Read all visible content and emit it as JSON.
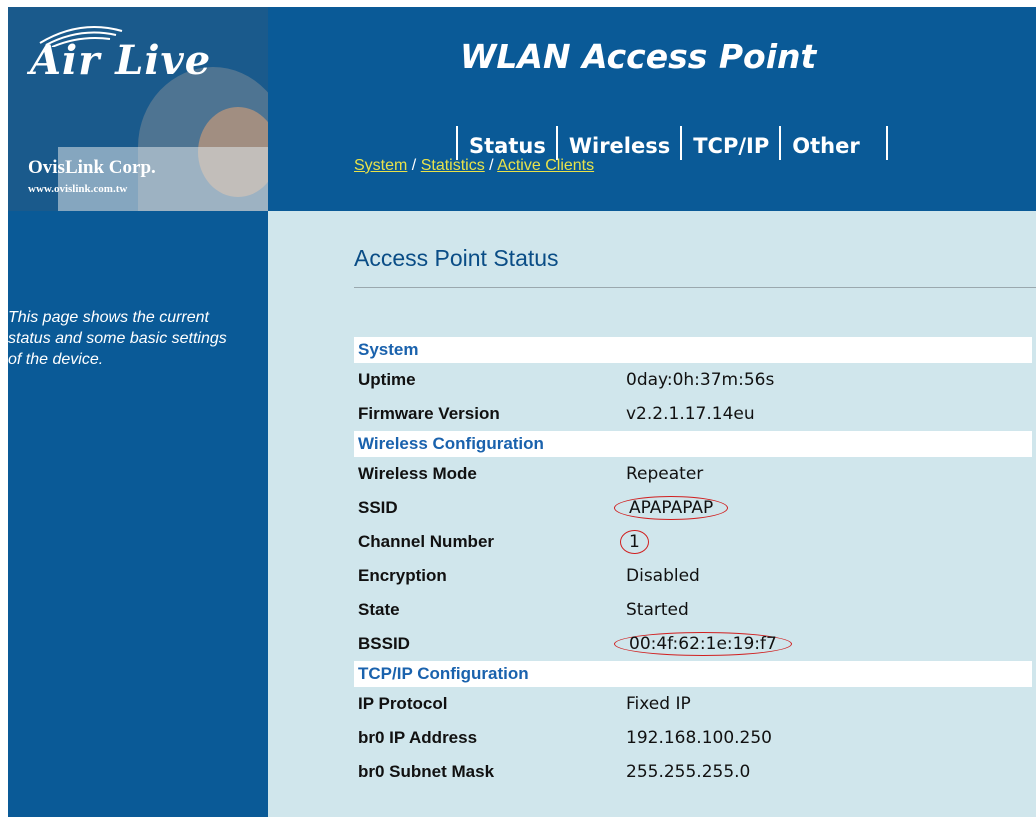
{
  "header": {
    "brand": "Air Live",
    "company": "OvisLink Corp.",
    "company_url": "www.ovislink.com.tw",
    "title": "WLAN Access Point",
    "tabs": [
      {
        "label": "Status"
      },
      {
        "label": "Wireless"
      },
      {
        "label": "TCP/IP"
      },
      {
        "label": "Other"
      }
    ],
    "subnav": {
      "system": "System",
      "statistics": "Statistics",
      "active_clients": "Active Clients",
      "separator": "/"
    }
  },
  "sidebar": {
    "description": "This page shows the current status and some basic settings of the device."
  },
  "main": {
    "title": "Access Point Status",
    "sections": {
      "system": {
        "title": "System",
        "rows": [
          {
            "label": "Uptime",
            "value": "0day:0h:37m:56s"
          },
          {
            "label": "Firmware Version",
            "value": "v2.2.1.17.14eu"
          }
        ]
      },
      "wireless": {
        "title": "Wireless Configuration",
        "rows": [
          {
            "label": "Wireless Mode",
            "value": "Repeater"
          },
          {
            "label": "SSID",
            "value": "APAPAPAP"
          },
          {
            "label": "Channel Number",
            "value": "1"
          },
          {
            "label": "Encryption",
            "value": "Disabled"
          },
          {
            "label": "State",
            "value": "Started"
          },
          {
            "label": "BSSID",
            "value": "00:4f:62:1e:19:f7"
          }
        ]
      },
      "tcpip": {
        "title": "TCP/IP Configuration",
        "rows": [
          {
            "label": "IP Protocol",
            "value": "Fixed IP"
          },
          {
            "label": "br0 IP Address",
            "value": "192.168.100.250"
          },
          {
            "label": "br0 Subnet Mask",
            "value": "255.255.255.0"
          }
        ]
      }
    }
  },
  "colors": {
    "header_bg": "#0a5a97",
    "content_bg": "#d0e6ec",
    "section_text": "#1a62ad",
    "link": "#e8e24a",
    "annotation": "#d02020"
  }
}
